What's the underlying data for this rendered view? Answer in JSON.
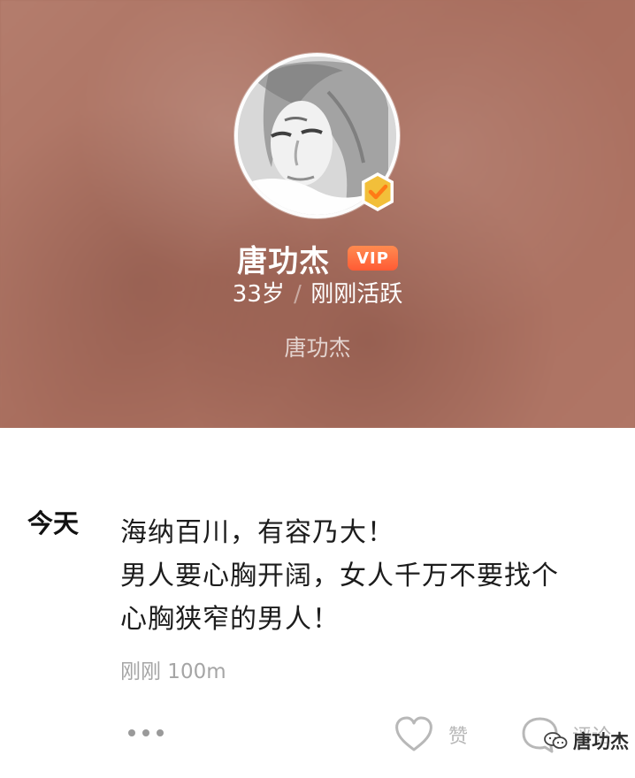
{
  "profile": {
    "name": "唐功杰",
    "vip_label": "VIP",
    "age": "33岁",
    "status": "刚刚活跃",
    "subtitle": "唐功杰",
    "verified_icon": "verified-badge-icon",
    "avatar_icon": "profile-avatar"
  },
  "post": {
    "day_label": "今天",
    "lines": [
      "海纳百川，有容乃大！",
      "男人要心胸开阔，女人千万不要找个",
      "心胸狭窄的男人！"
    ],
    "meta": "刚刚 100m",
    "actions": {
      "more_icon": "more-icon",
      "like_icon": "heart-icon",
      "like_label": "赞",
      "comment_icon": "comment-icon",
      "comment_label": "评论"
    }
  },
  "watermark": {
    "text": "唐功杰",
    "icon": "wechat-icon"
  },
  "colors": {
    "vip_start": "#ff8b50",
    "vip_end": "#ff5b35",
    "verified_gold": "#f2bf3a",
    "verified_check": "#ff7b16",
    "header_bg": "#a9705f",
    "muted_text": "#a5a5a5"
  }
}
